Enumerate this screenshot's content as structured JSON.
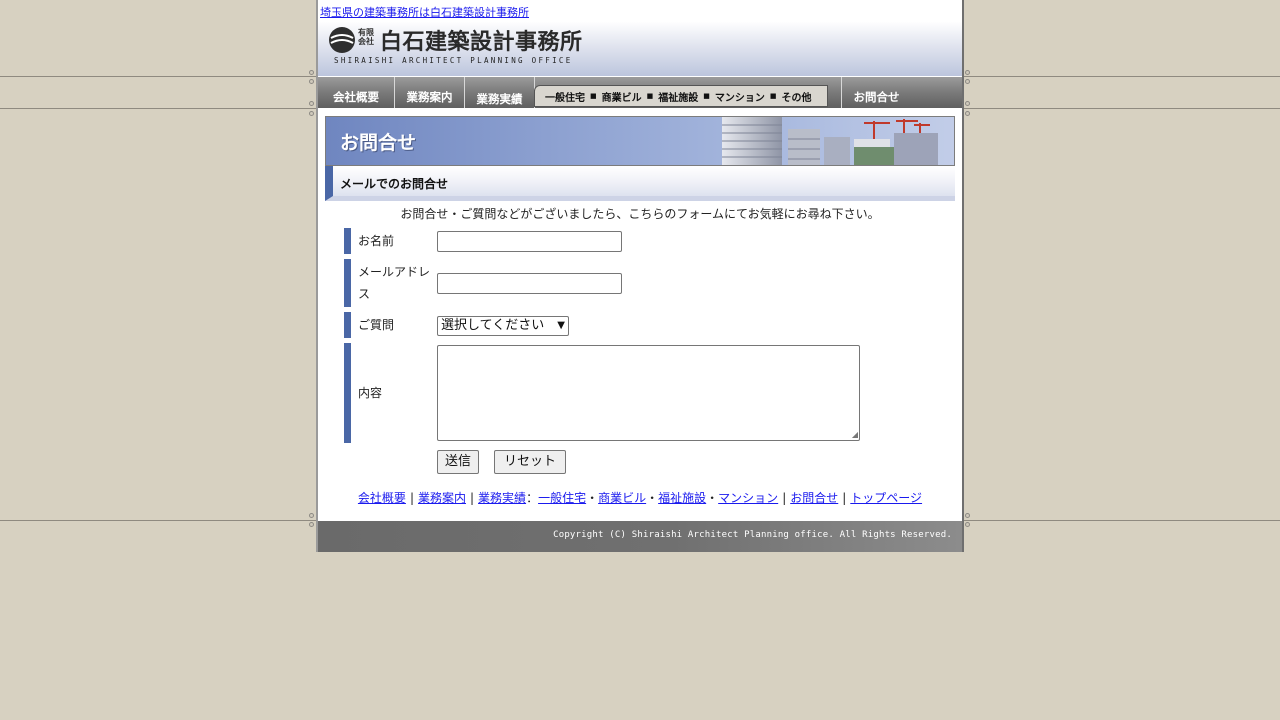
{
  "header": {
    "site_link": "埼玉県の建築事務所は白石建築設計事務所",
    "logo_small": "有限会社",
    "logo_name": "白石建築設計事務所",
    "logo_en": "SHIRAISHI ARCHITECT PLANNING OFFICE"
  },
  "nav": {
    "items": [
      "会社概要",
      "業務案内",
      "業務実績"
    ],
    "sub_items": [
      "一般住宅",
      "商業ビル",
      "福祉施設",
      "マンション",
      "その他"
    ],
    "contact": "お問合せ"
  },
  "page": {
    "title": "お問合せ",
    "section": "メールでのお問合せ",
    "intro": "お問合せ・ご質問などがございましたら、こちらのフォームにてお気軽にお尋ね下さい。"
  },
  "form": {
    "name_label": "お名前",
    "email_label": "メールアドレス",
    "question_label": "ご質問",
    "question_selected": "選択してください",
    "content_label": "内容",
    "submit": "送信",
    "reset": "リセット"
  },
  "footer": {
    "links": [
      "会社概要",
      "業務案内",
      "業務実績"
    ],
    "category_links": [
      "一般住宅",
      "商業ビル",
      "福祉施設",
      "マンション"
    ],
    "contact": "お問合せ",
    "top": "トップページ",
    "copyright": "Copyright (C) Shiraishi Architect Planning office. All Rights Reserved."
  },
  "colors": {
    "background": "#d7d1c1",
    "accent": "#4a67a6",
    "link": "#1a1aee"
  }
}
